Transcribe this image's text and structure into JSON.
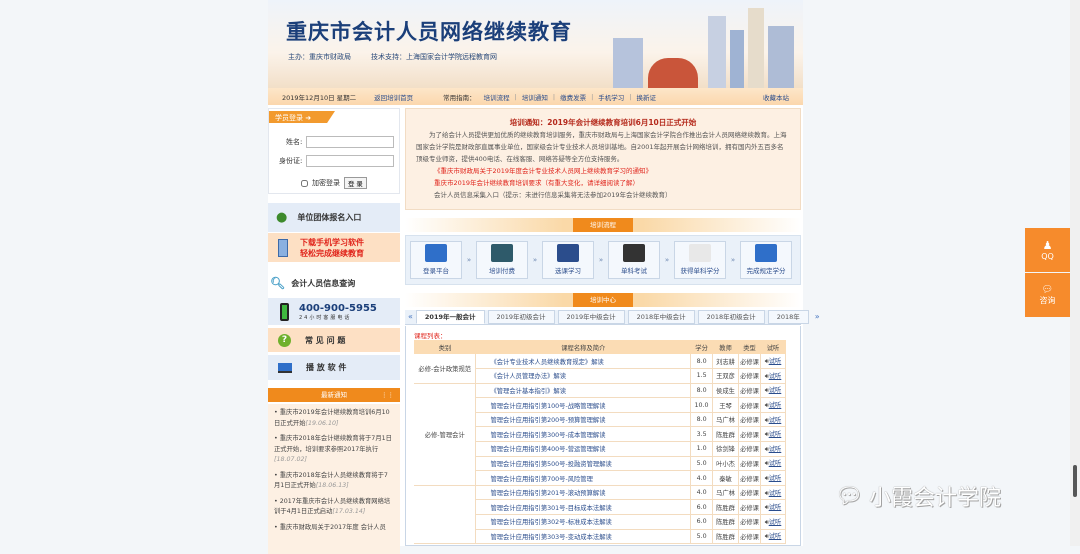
{
  "header": {
    "title": "重庆市会计人员网络继续教育",
    "host": "主办：重庆市财政局",
    "support": "技术支持：上海国家会计学院远程教育网"
  },
  "nav": {
    "date": "2019年12月10日 星期二",
    "home": "返回培训首页",
    "guide_label": "常用指南：",
    "links": [
      "培训流程",
      "培训通知",
      "缴费发票",
      "手机学习",
      "换新证"
    ],
    "bookmark": "收藏本站"
  },
  "login": {
    "title": "学员登录",
    "name_label": "姓名:",
    "name_value": "",
    "id_label": "身份证:",
    "id_value": "",
    "encrypt": "加密登录",
    "submit": "登 录"
  },
  "side": {
    "group_signup": "单位团体报名入口",
    "download1": "下载手机学习软件",
    "download2": "轻松完成继续教育",
    "info_query": "会计人员信息查询",
    "phone": "400-900-5955",
    "phone_sub": "24小时客服电话",
    "faq": "常 见 问 题",
    "player": "播 放 软 件",
    "news_title": "最新通知",
    "news": [
      {
        "text": "重庆市2019年会计继续教育培训6月10日正式开始",
        "date": "[19.06.10]"
      },
      {
        "text": "重庆市2018年会计继续教育将于7月1日正式开始，培训要求参照2017年执行",
        "date": "[18.07.02]"
      },
      {
        "text": "重庆市2018年会计人员继续教育将于7月1日正式开始",
        "date": "[18.06.13]"
      },
      {
        "text": "2017年重庆市会计人员继续教育网络培训于4月1日正式启动",
        "date": "[17.03.14]"
      },
      {
        "text": "重庆市财政局关于2017年度 会计人员",
        "date": ""
      }
    ]
  },
  "notice": {
    "title": "培训通知：2019年会计继续教育培训6月10日正式开始",
    "body": "为了给会计人员提供更加优质的继续教育培训服务，重庆市财政局与上海国家会计学院合作推出会计人员网络继续教育。上海国家会计学院是财政部直属事业单位，国家级会计专业技术人员培训基地。自2001年起开展会计网络培训，拥有国内外五百多名顶级专业师资，提供400电话、在线客服、网络答疑等全方位支持服务。",
    "link1": "《重庆市财政局关于2019年度会计专业技术人员网上继续教育学习的通知》",
    "link2": "重庆市2019年会计继续教育培训要求（有重大变化，请详细阅读了解）",
    "link3": "会计人员信息采集入口（提示：未进行信息采集将无法参加2019年会计继续教育）"
  },
  "process": {
    "title": "培训流程",
    "steps": [
      "登录平台",
      "培训付费",
      "选课学习",
      "单科考试",
      "获得单科学分",
      "完成规定学分"
    ],
    "arrow": "»"
  },
  "center": {
    "title": "培训中心",
    "tabs": [
      "2019年一般会计",
      "2019年初级会计",
      "2019年中级会计",
      "2018年中级会计",
      "2018年初级会计",
      "2018年"
    ],
    "prev": "«",
    "next": "»",
    "list_label": "课程列表：",
    "columns": [
      "类别",
      "课程名称及简介",
      "学分",
      "教师",
      "类型",
      "试听"
    ],
    "categories": [
      "必修-会计政策规范",
      "必修-管理会计",
      ""
    ],
    "rows": [
      {
        "name": "《会计专业技术人员继续教育规定》解读",
        "credit": "8.0",
        "teacher": "刘志耕",
        "type": "必修课",
        "listen": "试听"
      },
      {
        "name": "《会计人员管理办法》解读",
        "credit": "1.5",
        "teacher": "王双彦",
        "type": "必修课",
        "listen": "试听"
      },
      {
        "name": "《管理会计基本指引》解读",
        "credit": "8.0",
        "teacher": "侯成生",
        "type": "必修课",
        "listen": "试听"
      },
      {
        "name": "管理会计应用指引第100号-战略管理解读",
        "credit": "10.0",
        "teacher": "王琴",
        "type": "必修课",
        "listen": "试听"
      },
      {
        "name": "管理会计应用指引第200号-预算管理解读",
        "credit": "8.0",
        "teacher": "马广林",
        "type": "必修课",
        "listen": "试听"
      },
      {
        "name": "管理会计应用指引第300号-成本管理解读",
        "credit": "3.5",
        "teacher": "陈胜群",
        "type": "必修课",
        "listen": "试听"
      },
      {
        "name": "管理会计应用指引第400号-营运管理解读",
        "credit": "1.0",
        "teacher": "徐剑锋",
        "type": "必修课",
        "listen": "试听"
      },
      {
        "name": "管理会计应用指引第500号-投融资管理解读",
        "credit": "5.0",
        "teacher": "叶小杰",
        "type": "必修课",
        "listen": "试听"
      },
      {
        "name": "管理会计应用指引第700号-风险管理",
        "credit": "4.0",
        "teacher": "秦敏",
        "type": "必修课",
        "listen": "试听"
      },
      {
        "name": "管理会计应用指引第201号-滚动预算解读",
        "credit": "4.0",
        "teacher": "马广林",
        "type": "必修课",
        "listen": "试听"
      },
      {
        "name": "管理会计应用指引第301号-目标成本法解读",
        "credit": "6.0",
        "teacher": "陈胜群",
        "type": "必修课",
        "listen": "试听"
      },
      {
        "name": "管理会计应用指引第302号-标准成本法解读",
        "credit": "6.0",
        "teacher": "陈胜群",
        "type": "必修课",
        "listen": "试听"
      },
      {
        "name": "管理会计应用指引第303号-变动成本法解读",
        "credit": "5.0",
        "teacher": "陈胜群",
        "type": "必修课",
        "listen": "试听"
      }
    ]
  },
  "float": {
    "qq": "QQ",
    "consult": "咨询"
  },
  "watermark": "小霞会计学院",
  "colors": {
    "orange": "#f08a1c",
    "blue": "#2b4d8c",
    "red": "#e0251c"
  }
}
